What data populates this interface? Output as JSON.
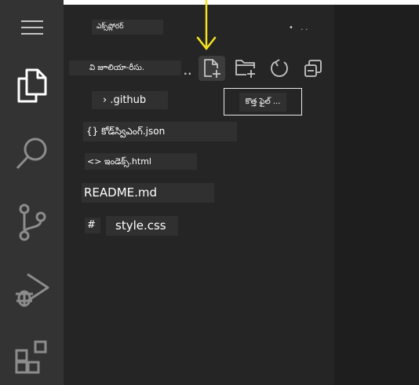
{
  "explorer": {
    "title": "ఎక్స్‌ప్లోరర్",
    "more_actions": "• ..",
    "folder_label": "వి జూలియా-రీసు.",
    "ellipsis": "..",
    "toolbar": {
      "new_file_tooltip": "కొత్త ఫైల్ ..."
    },
    "files": {
      "github": "› .github",
      "json": "{} కోడ్‌స్విఎంగ్.json",
      "html": "<> ఇండెక్స్.html",
      "readme": "README.md",
      "css_hash": "#",
      "css": "style.css"
    }
  },
  "colors": {
    "activity_bar": "#333333",
    "sidebar": "#252526",
    "editor": "#1e1e1e",
    "arrow": "#f5e31f",
    "icon": "#c5c5c5"
  },
  "icons": [
    "menu-icon",
    "files-icon",
    "search-icon",
    "source-control-icon",
    "run-debug-icon",
    "extensions-icon",
    "new-file-icon",
    "new-folder-icon",
    "refresh-icon",
    "collapse-all-icon",
    "arrow-down-icon"
  ]
}
